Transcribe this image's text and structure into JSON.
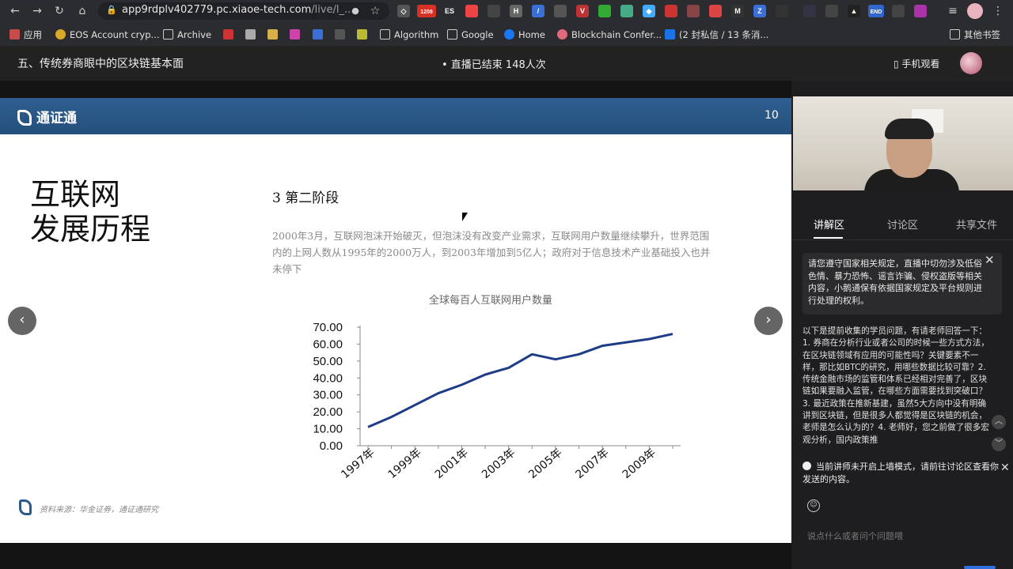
{
  "browser": {
    "url_main": "app9rdplv402779.pc.xiaoe-tech.com",
    "url_rest": "/live/l_...",
    "ext_badges": {
      "badge1": "1208",
      "badge2": "ES",
      "badge3": "END"
    },
    "bookmarks": [
      {
        "label": "应用",
        "color": "#c64b4b"
      },
      {
        "label": "EOS Account cryp...",
        "color": "#d9a82a"
      },
      {
        "label": "Archive",
        "color": "#8ab4f8"
      },
      {
        "label": "Algorithm",
        "color": "#8ab4f8"
      },
      {
        "label": "Google",
        "color": "#8ab4f8"
      },
      {
        "label": "Home",
        "color": "#1877f2"
      },
      {
        "label": "Blockchain Confer...",
        "color": "#e06a7a"
      },
      {
        "label": "(2 封私信 / 13 条消...",
        "color": "#1a73e8"
      },
      {
        "label": "其他书签",
        "color": "#8ab4f8"
      }
    ]
  },
  "topbar": {
    "course_title": "五、传统券商眼中的区块链基本面",
    "live_status": "• 直播已结束  148人次",
    "mobile_view": "手机观看"
  },
  "slide": {
    "brand": "通证通",
    "page_number": "10",
    "big_title_1": "互联网",
    "big_title_2": "发展历程",
    "stage_title": "3 第二阶段",
    "paragraph": "2000年3月，互联网泡沫开始破灭，但泡沫没有改变产业需求，互联网用户数量继续攀升，世界范围内的上网人数从1995年的2000万人，到2003年增加到5亿人；政府对于信息技术产业基础投入也并未停下",
    "chart_title": "全球每百人互联网用户数量",
    "source": "资料来源：华金证券，通证通研究"
  },
  "chart_data": {
    "type": "line",
    "title": "全球每百人互联网用户数量",
    "x": [
      "1997年",
      "1998年",
      "1999年",
      "2000年",
      "2001年",
      "2002年",
      "2003年",
      "2004年",
      "2005年",
      "2006年",
      "2007年",
      "2008年",
      "2009年",
      "2010年"
    ],
    "xtick_labels": [
      "1997年",
      "1999年",
      "2001年",
      "2003年",
      "2005年",
      "2007年",
      "2009年"
    ],
    "series": [
      {
        "values": [
          11,
          17,
          24,
          31,
          36,
          42,
          46,
          54,
          51,
          54,
          59,
          61,
          63,
          66
        ]
      }
    ],
    "ylim": [
      0,
      70
    ],
    "yticks": [
      "0.00",
      "10.00",
      "20.00",
      "30.00",
      "40.00",
      "50.00",
      "60.00",
      "70.00"
    ],
    "line_color": "#1f3c88",
    "grid": false
  },
  "sidebar": {
    "tabs": [
      "讲解区",
      "讨论区",
      "共享文件"
    ],
    "notice": "请您遵守国家相关规定，直播中切勿涉及低俗色情、暴力恐怖、谣言诈骗、侵权盗版等相关内容，小鹅通保有依据国家规定及平台规则进行处理的权利。",
    "questions": "以下是提前收集的学员问题，有请老师回答一下：1. 券商在分析行业或者公司的时候一些方式方法，在区块链领域有应用的可能性吗？关键要素不一样，那比如BTC的研究，用哪些数据比较可靠？2. 传统金融市场的监管和体系已经相对完善了，区块链如果要融入监管，在哪些方面需要找到突破口？3. 最近政策在推新基建，虽然5大方向中没有明确讲到区块链，但是很多人都觉得是区块链的机会，老师是怎么认为的？4. 老师好，您之前做了很多宏观分析，国内政策推",
    "tip": "当前讲师未开启上墙模式，请前往讨论区查看你发送的内容。",
    "input_placeholder": "说点什么或者问个问题喂"
  }
}
